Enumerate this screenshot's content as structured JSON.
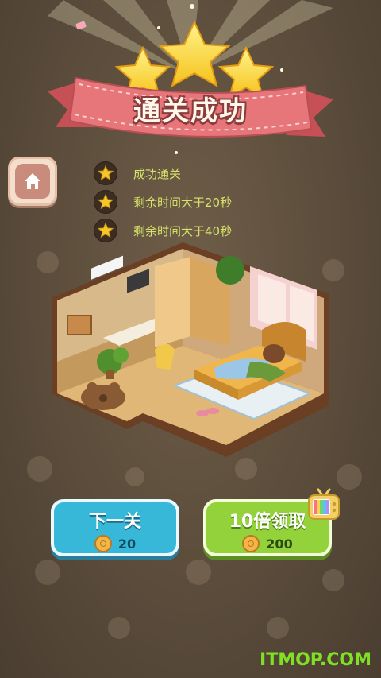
{
  "title": "通关成功",
  "objectives": [
    {
      "text": "成功通关"
    },
    {
      "text": "剩余时间大于20秒"
    },
    {
      "text": "剩余时间大于40秒"
    }
  ],
  "buttons": {
    "next": {
      "label": "下一关",
      "coin_amount": "20"
    },
    "reward": {
      "label": "10倍领取",
      "coin_amount": "200"
    }
  },
  "watermark": "ITMOP.COM",
  "colors": {
    "objective_text": "#d6e36a",
    "next_button": "#38b8d8",
    "reward_button": "#93d23a",
    "ribbon": "#e6767a"
  }
}
